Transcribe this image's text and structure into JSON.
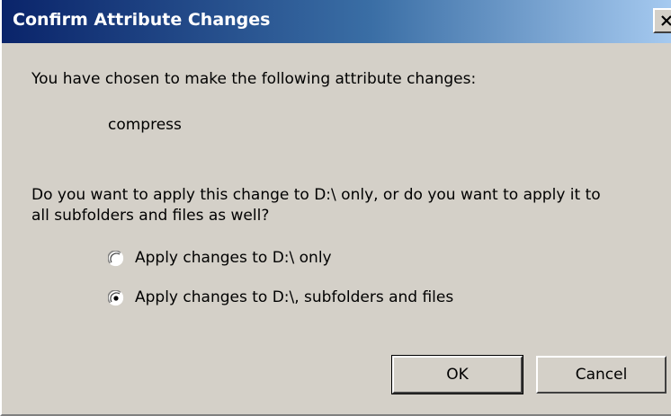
{
  "dialog": {
    "title": "Confirm Attribute Changes",
    "intro": "You have chosen to make the following attribute changes:",
    "attribute": "compress",
    "question_line1": "Do you want to apply this change to D:\\ only, or do you want to apply it to",
    "question_line2": "all subfolders and files as well?",
    "options": [
      {
        "label": "Apply changes to D:\\ only",
        "selected": false
      },
      {
        "label": "Apply changes to D:\\, subfolders and files",
        "selected": true
      }
    ],
    "ok_label": "OK",
    "cancel_label": "Cancel"
  },
  "colors": {
    "face": "#d4d0c8",
    "title_start": "#0a246a",
    "title_end": "#a6caf0"
  },
  "icons": {
    "close": "close-icon",
    "radio_off": "radio-unselected-icon",
    "radio_on": "radio-selected-icon"
  }
}
